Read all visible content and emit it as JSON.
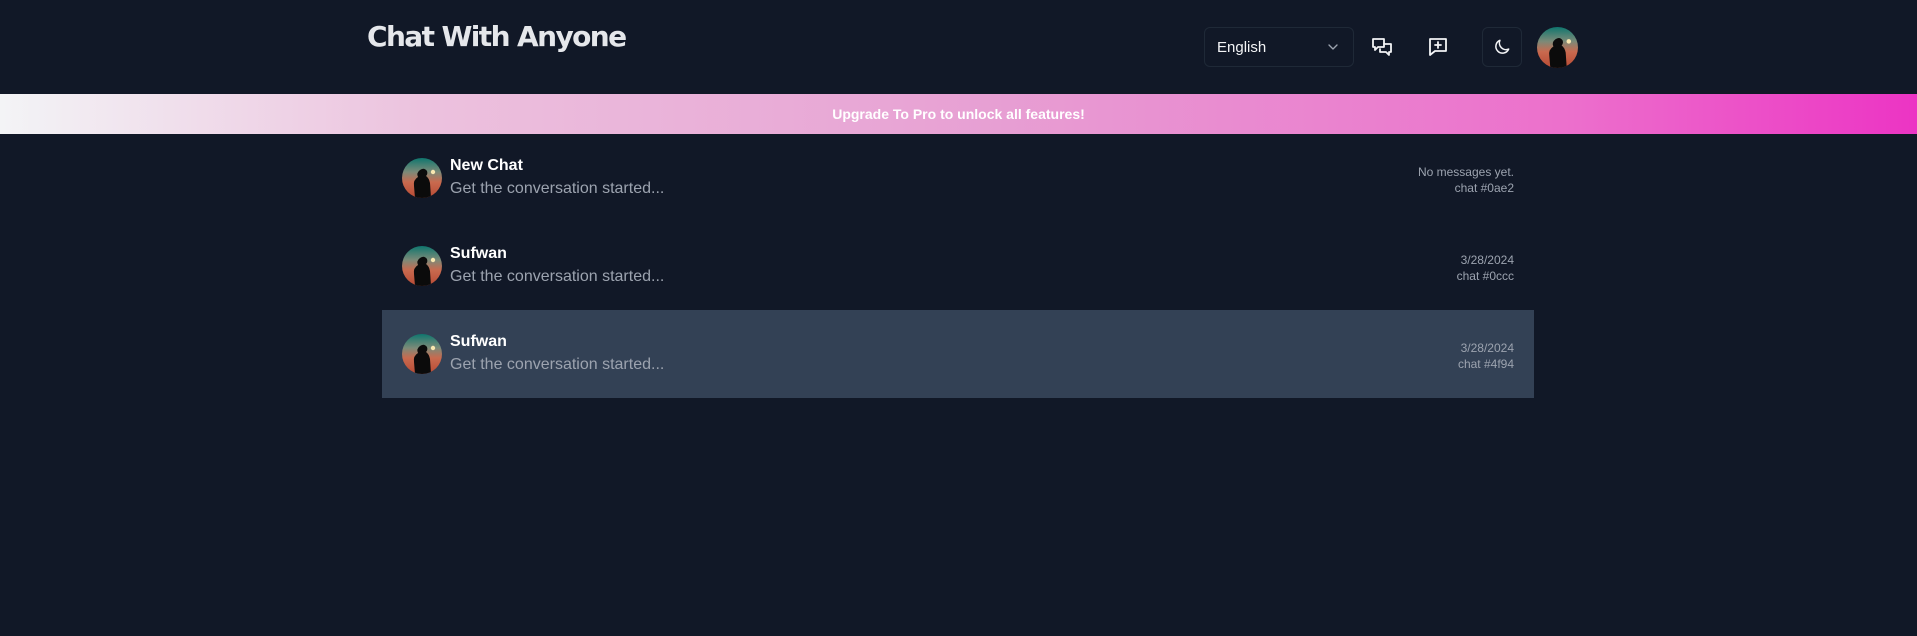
{
  "header": {
    "logo": "Chat With Anyone",
    "language": {
      "selected": "English"
    },
    "icons": {
      "chats": "chats-icon",
      "new_chat": "message-plus-icon",
      "theme": "moon-icon",
      "avatar": "user-avatar"
    }
  },
  "banner": {
    "text": "Upgrade To Pro to unlock all features!"
  },
  "chats": [
    {
      "name": "New Chat",
      "preview": "Get the conversation started...",
      "date": "No messages yet.",
      "id": "chat #0ae2"
    },
    {
      "name": "Sufwan",
      "preview": "Get the conversation started...",
      "date": "3/28/2024",
      "id": "chat #0ccc"
    },
    {
      "name": "Sufwan",
      "preview": "Get the conversation started...",
      "date": "3/28/2024",
      "id": "chat #4f94",
      "active": true
    }
  ],
  "colors": {
    "background": "#111827",
    "active_row": "#334155",
    "muted_text": "#9ca3af",
    "banner_start": "#f3f4f6",
    "banner_end": "#ec34c4"
  }
}
